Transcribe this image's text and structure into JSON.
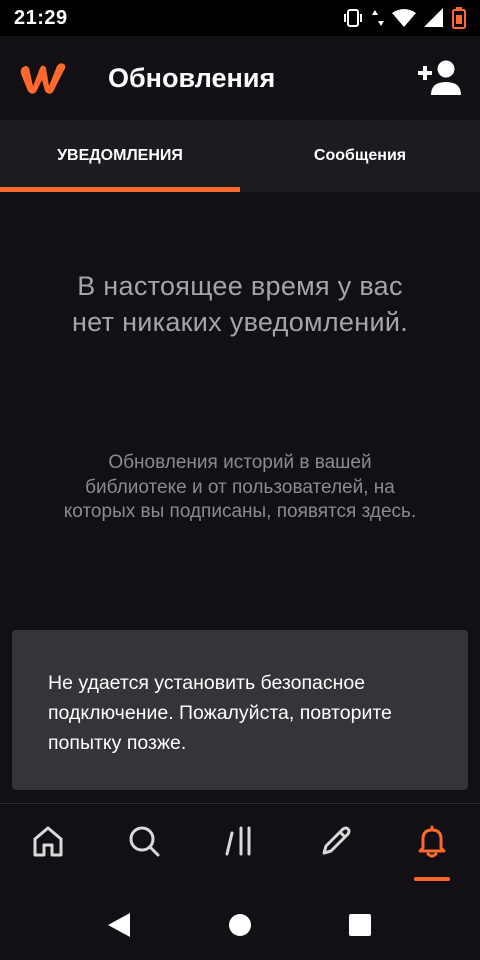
{
  "status_bar": {
    "time": "21:29",
    "icons": [
      "vibrate-icon",
      "data-arrows-icon",
      "wifi-icon",
      "signal-icon",
      "battery-icon"
    ]
  },
  "app_bar": {
    "logo_icon": "wattpad-logo-icon",
    "title": "Обновления",
    "action_icon": "add-user-icon"
  },
  "tabs": [
    {
      "label": "УВЕДОМЛЕНИЯ",
      "active": true
    },
    {
      "label": "Сообщения",
      "active": false
    }
  ],
  "empty_state": {
    "title": "В настоящее время у вас нет никаких уведомлений.",
    "description": "Обновления историй в вашей библиотеке и от пользователей, на которых вы подписаны, появятся здесь."
  },
  "snackbar": {
    "message": "Не удается установить безопасное подключение. Пожалуйста, повторите попытку позже."
  },
  "bottom_nav": {
    "items": [
      "home-icon",
      "search-icon",
      "library-icon",
      "write-icon",
      "notifications-icon"
    ],
    "active": "notifications-icon"
  },
  "system_nav": [
    "back-icon",
    "home-circle-icon",
    "recents-icon"
  ],
  "colors": {
    "accent": "#ff6a2c",
    "background": "#121014",
    "tab_bar": "#1d1b20",
    "snackbar": "#363438"
  }
}
